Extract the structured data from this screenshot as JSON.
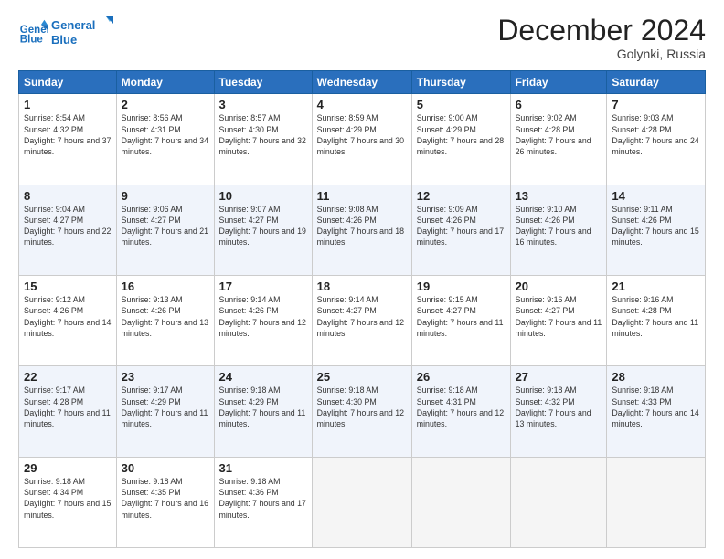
{
  "header": {
    "logo_line1": "General",
    "logo_line2": "Blue",
    "month": "December 2024",
    "location": "Golynki, Russia"
  },
  "weekdays": [
    "Sunday",
    "Monday",
    "Tuesday",
    "Wednesday",
    "Thursday",
    "Friday",
    "Saturday"
  ],
  "weeks": [
    [
      {
        "day": "1",
        "sunrise": "Sunrise: 8:54 AM",
        "sunset": "Sunset: 4:32 PM",
        "daylight": "Daylight: 7 hours and 37 minutes."
      },
      {
        "day": "2",
        "sunrise": "Sunrise: 8:56 AM",
        "sunset": "Sunset: 4:31 PM",
        "daylight": "Daylight: 7 hours and 34 minutes."
      },
      {
        "day": "3",
        "sunrise": "Sunrise: 8:57 AM",
        "sunset": "Sunset: 4:30 PM",
        "daylight": "Daylight: 7 hours and 32 minutes."
      },
      {
        "day": "4",
        "sunrise": "Sunrise: 8:59 AM",
        "sunset": "Sunset: 4:29 PM",
        "daylight": "Daylight: 7 hours and 30 minutes."
      },
      {
        "day": "5",
        "sunrise": "Sunrise: 9:00 AM",
        "sunset": "Sunset: 4:29 PM",
        "daylight": "Daylight: 7 hours and 28 minutes."
      },
      {
        "day": "6",
        "sunrise": "Sunrise: 9:02 AM",
        "sunset": "Sunset: 4:28 PM",
        "daylight": "Daylight: 7 hours and 26 minutes."
      },
      {
        "day": "7",
        "sunrise": "Sunrise: 9:03 AM",
        "sunset": "Sunset: 4:28 PM",
        "daylight": "Daylight: 7 hours and 24 minutes."
      }
    ],
    [
      {
        "day": "8",
        "sunrise": "Sunrise: 9:04 AM",
        "sunset": "Sunset: 4:27 PM",
        "daylight": "Daylight: 7 hours and 22 minutes."
      },
      {
        "day": "9",
        "sunrise": "Sunrise: 9:06 AM",
        "sunset": "Sunset: 4:27 PM",
        "daylight": "Daylight: 7 hours and 21 minutes."
      },
      {
        "day": "10",
        "sunrise": "Sunrise: 9:07 AM",
        "sunset": "Sunset: 4:27 PM",
        "daylight": "Daylight: 7 hours and 19 minutes."
      },
      {
        "day": "11",
        "sunrise": "Sunrise: 9:08 AM",
        "sunset": "Sunset: 4:26 PM",
        "daylight": "Daylight: 7 hours and 18 minutes."
      },
      {
        "day": "12",
        "sunrise": "Sunrise: 9:09 AM",
        "sunset": "Sunset: 4:26 PM",
        "daylight": "Daylight: 7 hours and 17 minutes."
      },
      {
        "day": "13",
        "sunrise": "Sunrise: 9:10 AM",
        "sunset": "Sunset: 4:26 PM",
        "daylight": "Daylight: 7 hours and 16 minutes."
      },
      {
        "day": "14",
        "sunrise": "Sunrise: 9:11 AM",
        "sunset": "Sunset: 4:26 PM",
        "daylight": "Daylight: 7 hours and 15 minutes."
      }
    ],
    [
      {
        "day": "15",
        "sunrise": "Sunrise: 9:12 AM",
        "sunset": "Sunset: 4:26 PM",
        "daylight": "Daylight: 7 hours and 14 minutes."
      },
      {
        "day": "16",
        "sunrise": "Sunrise: 9:13 AM",
        "sunset": "Sunset: 4:26 PM",
        "daylight": "Daylight: 7 hours and 13 minutes."
      },
      {
        "day": "17",
        "sunrise": "Sunrise: 9:14 AM",
        "sunset": "Sunset: 4:26 PM",
        "daylight": "Daylight: 7 hours and 12 minutes."
      },
      {
        "day": "18",
        "sunrise": "Sunrise: 9:14 AM",
        "sunset": "Sunset: 4:27 PM",
        "daylight": "Daylight: 7 hours and 12 minutes."
      },
      {
        "day": "19",
        "sunrise": "Sunrise: 9:15 AM",
        "sunset": "Sunset: 4:27 PM",
        "daylight": "Daylight: 7 hours and 11 minutes."
      },
      {
        "day": "20",
        "sunrise": "Sunrise: 9:16 AM",
        "sunset": "Sunset: 4:27 PM",
        "daylight": "Daylight: 7 hours and 11 minutes."
      },
      {
        "day": "21",
        "sunrise": "Sunrise: 9:16 AM",
        "sunset": "Sunset: 4:28 PM",
        "daylight": "Daylight: 7 hours and 11 minutes."
      }
    ],
    [
      {
        "day": "22",
        "sunrise": "Sunrise: 9:17 AM",
        "sunset": "Sunset: 4:28 PM",
        "daylight": "Daylight: 7 hours and 11 minutes."
      },
      {
        "day": "23",
        "sunrise": "Sunrise: 9:17 AM",
        "sunset": "Sunset: 4:29 PM",
        "daylight": "Daylight: 7 hours and 11 minutes."
      },
      {
        "day": "24",
        "sunrise": "Sunrise: 9:18 AM",
        "sunset": "Sunset: 4:29 PM",
        "daylight": "Daylight: 7 hours and 11 minutes."
      },
      {
        "day": "25",
        "sunrise": "Sunrise: 9:18 AM",
        "sunset": "Sunset: 4:30 PM",
        "daylight": "Daylight: 7 hours and 12 minutes."
      },
      {
        "day": "26",
        "sunrise": "Sunrise: 9:18 AM",
        "sunset": "Sunset: 4:31 PM",
        "daylight": "Daylight: 7 hours and 12 minutes."
      },
      {
        "day": "27",
        "sunrise": "Sunrise: 9:18 AM",
        "sunset": "Sunset: 4:32 PM",
        "daylight": "Daylight: 7 hours and 13 minutes."
      },
      {
        "day": "28",
        "sunrise": "Sunrise: 9:18 AM",
        "sunset": "Sunset: 4:33 PM",
        "daylight": "Daylight: 7 hours and 14 minutes."
      }
    ],
    [
      {
        "day": "29",
        "sunrise": "Sunrise: 9:18 AM",
        "sunset": "Sunset: 4:34 PM",
        "daylight": "Daylight: 7 hours and 15 minutes."
      },
      {
        "day": "30",
        "sunrise": "Sunrise: 9:18 AM",
        "sunset": "Sunset: 4:35 PM",
        "daylight": "Daylight: 7 hours and 16 minutes."
      },
      {
        "day": "31",
        "sunrise": "Sunrise: 9:18 AM",
        "sunset": "Sunset: 4:36 PM",
        "daylight": "Daylight: 7 hours and 17 minutes."
      },
      null,
      null,
      null,
      null
    ]
  ]
}
